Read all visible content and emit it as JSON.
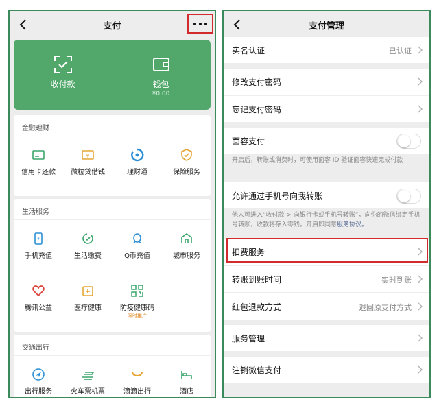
{
  "colors": {
    "accent_green": "#52a86b",
    "panel_border": "#3a8a5c",
    "highlight_red": "#d12b2b",
    "link_blue": "#576b95",
    "tag_orange": "#e08a2a"
  },
  "left": {
    "title": "支付",
    "back_icon": "chevron-left-icon",
    "more_icon": "more-dots-icon",
    "green_card": {
      "receive": {
        "label": "收付款",
        "icon": "scan-check-icon"
      },
      "wallet": {
        "label": "钱包",
        "balance": "¥0.00",
        "icon": "wallet-icon"
      }
    },
    "finance": {
      "title": "金融理财",
      "items": [
        {
          "label": "信用卡还款",
          "icon": "credit-card-icon"
        },
        {
          "label": "微粒贷借钱",
          "icon": "loan-icon"
        },
        {
          "label": "理财通",
          "icon": "wealth-icon"
        },
        {
          "label": "保险服务",
          "icon": "insurance-icon"
        }
      ]
    },
    "life": {
      "title": "生活服务",
      "items": [
        {
          "label": "手机充值",
          "icon": "phone-topup-icon"
        },
        {
          "label": "生活缴费",
          "icon": "utility-bill-icon"
        },
        {
          "label": "Q币充值",
          "icon": "qq-coin-icon"
        },
        {
          "label": "城市服务",
          "icon": "city-service-icon"
        },
        {
          "label": "腾讯公益",
          "icon": "charity-heart-icon"
        },
        {
          "label": "医疗健康",
          "icon": "medical-icon"
        },
        {
          "label": "防疫健康码",
          "icon": "qr-code-icon",
          "tag": "限时推广"
        }
      ]
    },
    "transport": {
      "title": "交通出行",
      "items": [
        {
          "label": "出行服务",
          "icon": "navigation-icon"
        },
        {
          "label": "火车票机票",
          "icon": "train-icon"
        },
        {
          "label": "滴滴出行",
          "icon": "didi-icon"
        },
        {
          "label": "酒店",
          "icon": "hotel-bed-icon"
        }
      ]
    }
  },
  "right": {
    "title": "支付管理",
    "rows": {
      "realname": {
        "label": "实名认证",
        "value": "已认证"
      },
      "modify_pwd": {
        "label": "修改支付密码"
      },
      "forgot_pwd": {
        "label": "忘记支付密码"
      },
      "face_pay": {
        "label": "面容支付",
        "on": false
      },
      "face_note": "开启后，转账或消费时，可使用面容 ID 验证面容快速完成付款",
      "phone_transfer": {
        "label": "允许通过手机号向我转账",
        "on": false
      },
      "phone_note_text": "他人可进入“收付款 > 向银行卡或手机号转账”，向你的微信绑定手机号转账，收款将存入零钱。开启即同意",
      "phone_note_link": "服务协议。",
      "deduction": {
        "label": "扣费服务"
      },
      "arrival_time": {
        "label": "转账到账时间",
        "value": "实时到账"
      },
      "red_packet_refund": {
        "label": "红包退款方式",
        "value": "退回原支付方式"
      },
      "service_mgmt": {
        "label": "服务管理"
      },
      "cancel_pay": {
        "label": "注销微信支付"
      }
    }
  }
}
